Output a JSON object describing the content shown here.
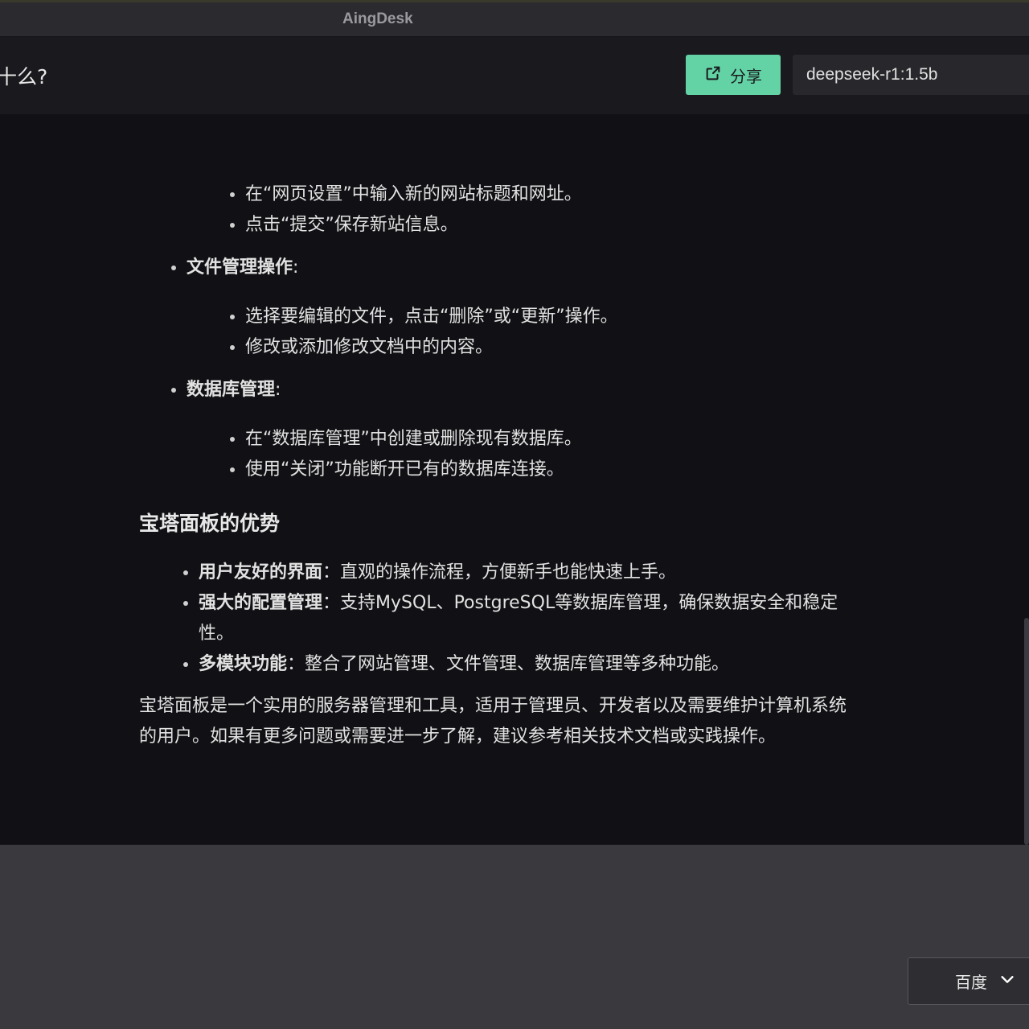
{
  "window": {
    "title": "AingDesk"
  },
  "header": {
    "chat_title": "十么?",
    "share_label": "分享",
    "model": "deepseek-r1:1.5b"
  },
  "message": {
    "block1_items": [
      "在“网页设置”中输入新的网站标题和网址。",
      "点击“提交”保存新站信息。"
    ],
    "file_ops": {
      "label": "文件管理操作",
      "colon": ":",
      "items": [
        "选择要编辑的文件，点击“删除”或“更新”操作。",
        "修改或添加修改文档中的内容。"
      ]
    },
    "db_ops": {
      "label": "数据库管理",
      "colon": ":",
      "items": [
        "在“数据库管理”中创建或删除现有数据库。",
        "使用“关闭”功能断开已有的数据库连接。"
      ]
    },
    "adv_heading": "宝塔面板的优势",
    "advantages": [
      {
        "title": "用户友好的界面",
        "sep": "：",
        "text": "直观的操作流程，方便新手也能快速上手。"
      },
      {
        "title": "强大的配置管理",
        "sep": "：",
        "text": "支持MySQL、PostgreSQL等数据库管理，确保数据安全和稳定性。"
      },
      {
        "title": "多模块功能",
        "sep": "：",
        "text": "整合了网站管理、文件管理、数据库管理等多种功能。"
      }
    ],
    "summary": "宝塔面板是一个实用的服务器管理和工具，适用于管理员、开发者以及需要维护计算机系统的用户。如果有更多问题或需要进一步了解，建议参考相关技术文档或实践操作。"
  },
  "composer": {
    "search_engine": "百度"
  },
  "colors": {
    "accent": "#63d3a6",
    "content_bg": "#111115"
  },
  "icons": {
    "share": "share-icon",
    "dropdown": "chevron-down-icon"
  }
}
